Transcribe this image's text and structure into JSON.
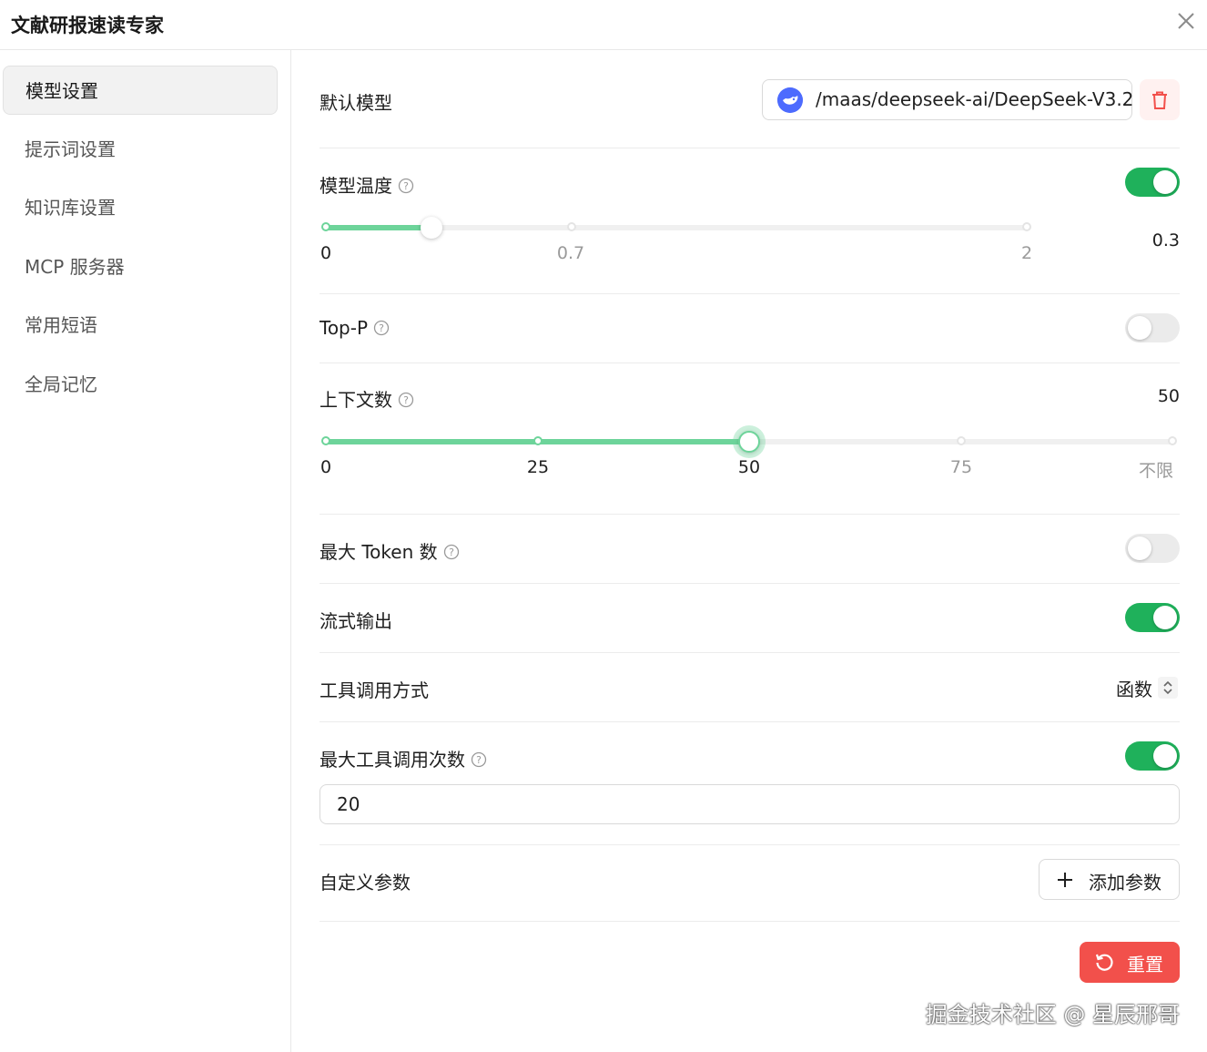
{
  "window": {
    "title": "文献研报速读专家"
  },
  "sidebar": {
    "items": [
      {
        "label": "模型设置",
        "active": true
      },
      {
        "label": "提示词设置"
      },
      {
        "label": "知识库设置"
      },
      {
        "label": "MCP 服务器"
      },
      {
        "label": "常用短语"
      },
      {
        "label": "全局记忆"
      }
    ]
  },
  "settings": {
    "default_model": {
      "label": "默认模型",
      "value": "/maas/deepseek-ai/DeepSeek-V3.2"
    },
    "temperature": {
      "label": "模型温度",
      "enabled": true,
      "value": "0.3",
      "min": 0,
      "max": 2,
      "current": 0.3,
      "marks": [
        "0",
        "0.7",
        "2"
      ]
    },
    "top_p": {
      "label": "Top-P",
      "enabled": false
    },
    "context_count": {
      "label": "上下文数",
      "value": "50",
      "current_fraction": 0.5,
      "marks": [
        "0",
        "25",
        "50",
        "75",
        "不限"
      ]
    },
    "max_tokens": {
      "label": "最大 Token 数",
      "enabled": false
    },
    "stream_output": {
      "label": "流式输出",
      "enabled": true
    },
    "tool_call_mode": {
      "label": "工具调用方式",
      "value": "函数"
    },
    "max_tool_calls": {
      "label": "最大工具调用次数",
      "enabled": true,
      "value": "20"
    },
    "custom_params": {
      "label": "自定义参数",
      "add_label": "添加参数"
    },
    "reset_label": "重置"
  },
  "watermark": "掘金技术社区 @ 星辰邢哥",
  "colors": {
    "accent": "#1fb15b",
    "slider_fill": "#6dd49a",
    "danger": "#f2504b",
    "model_logo": "#4d6bfe"
  },
  "icons": {
    "close": "close-icon",
    "trash": "trash-icon",
    "help": "help-circle-icon",
    "select": "chevron-up-down-icon",
    "plus": "plus-icon",
    "reset": "reset-icon"
  }
}
